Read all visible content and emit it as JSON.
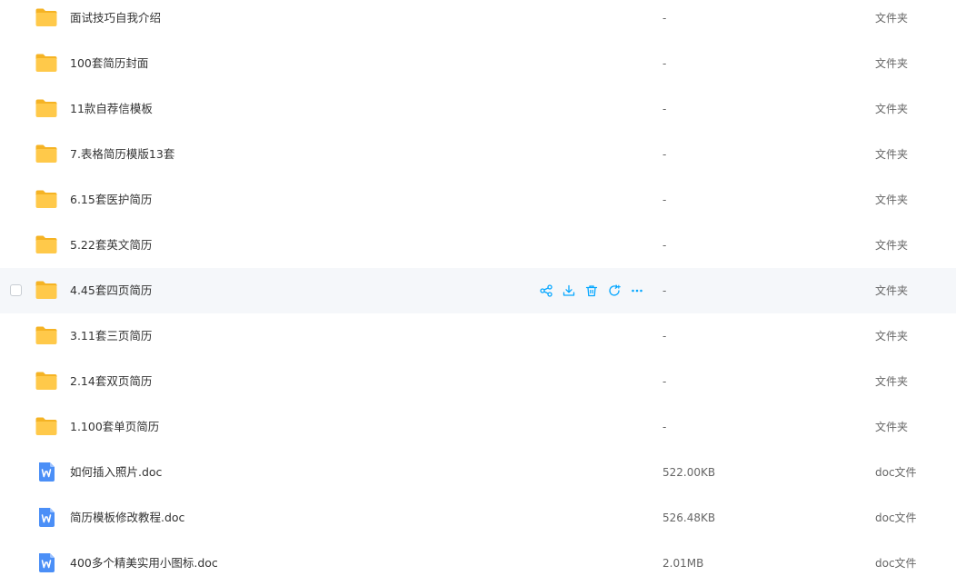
{
  "files": [
    {
      "name": "面试技巧自我介绍",
      "size": "-",
      "type": "文件夹",
      "kind": "folder-icon"
    },
    {
      "name": "100套简历封面",
      "size": "-",
      "type": "文件夹",
      "kind": "folder-icon"
    },
    {
      "name": "11款自荐信模板",
      "size": "-",
      "type": "文件夹",
      "kind": "folder-icon"
    },
    {
      "name": "7.表格简历模版13套",
      "size": "-",
      "type": "文件夹",
      "kind": "folder-icon"
    },
    {
      "name": "6.15套医护简历",
      "size": "-",
      "type": "文件夹",
      "kind": "folder-icon"
    },
    {
      "name": "5.22套英文简历",
      "size": "-",
      "type": "文件夹",
      "kind": "folder-icon"
    },
    {
      "name": "4.45套四页简历",
      "size": "-",
      "type": "文件夹",
      "kind": "folder-icon",
      "hovered": true
    },
    {
      "name": "3.11套三页简历",
      "size": "-",
      "type": "文件夹",
      "kind": "folder-icon"
    },
    {
      "name": "2.14套双页简历",
      "size": "-",
      "type": "文件夹",
      "kind": "folder-icon"
    },
    {
      "name": "1.100套单页简历",
      "size": "-",
      "type": "文件夹",
      "kind": "folder-icon"
    },
    {
      "name": "如何插入照片.doc",
      "size": "522.00KB",
      "type": "doc文件",
      "kind": "word-doc-icon"
    },
    {
      "name": "简历模板修改教程.doc",
      "size": "526.48KB",
      "type": "doc文件",
      "kind": "word-doc-icon"
    },
    {
      "name": "400多个精美实用小图标.doc",
      "size": "2.01MB",
      "type": "doc文件",
      "kind": "word-doc-icon"
    }
  ],
  "row_actions": [
    "share-icon",
    "download-icon",
    "delete-icon",
    "move-icon",
    "more-icon"
  ],
  "colors": {
    "accent": "#06a7ff",
    "hover_row": "#f5f7fa",
    "folder": "#ffc94a",
    "word": "#4b8ff7"
  }
}
